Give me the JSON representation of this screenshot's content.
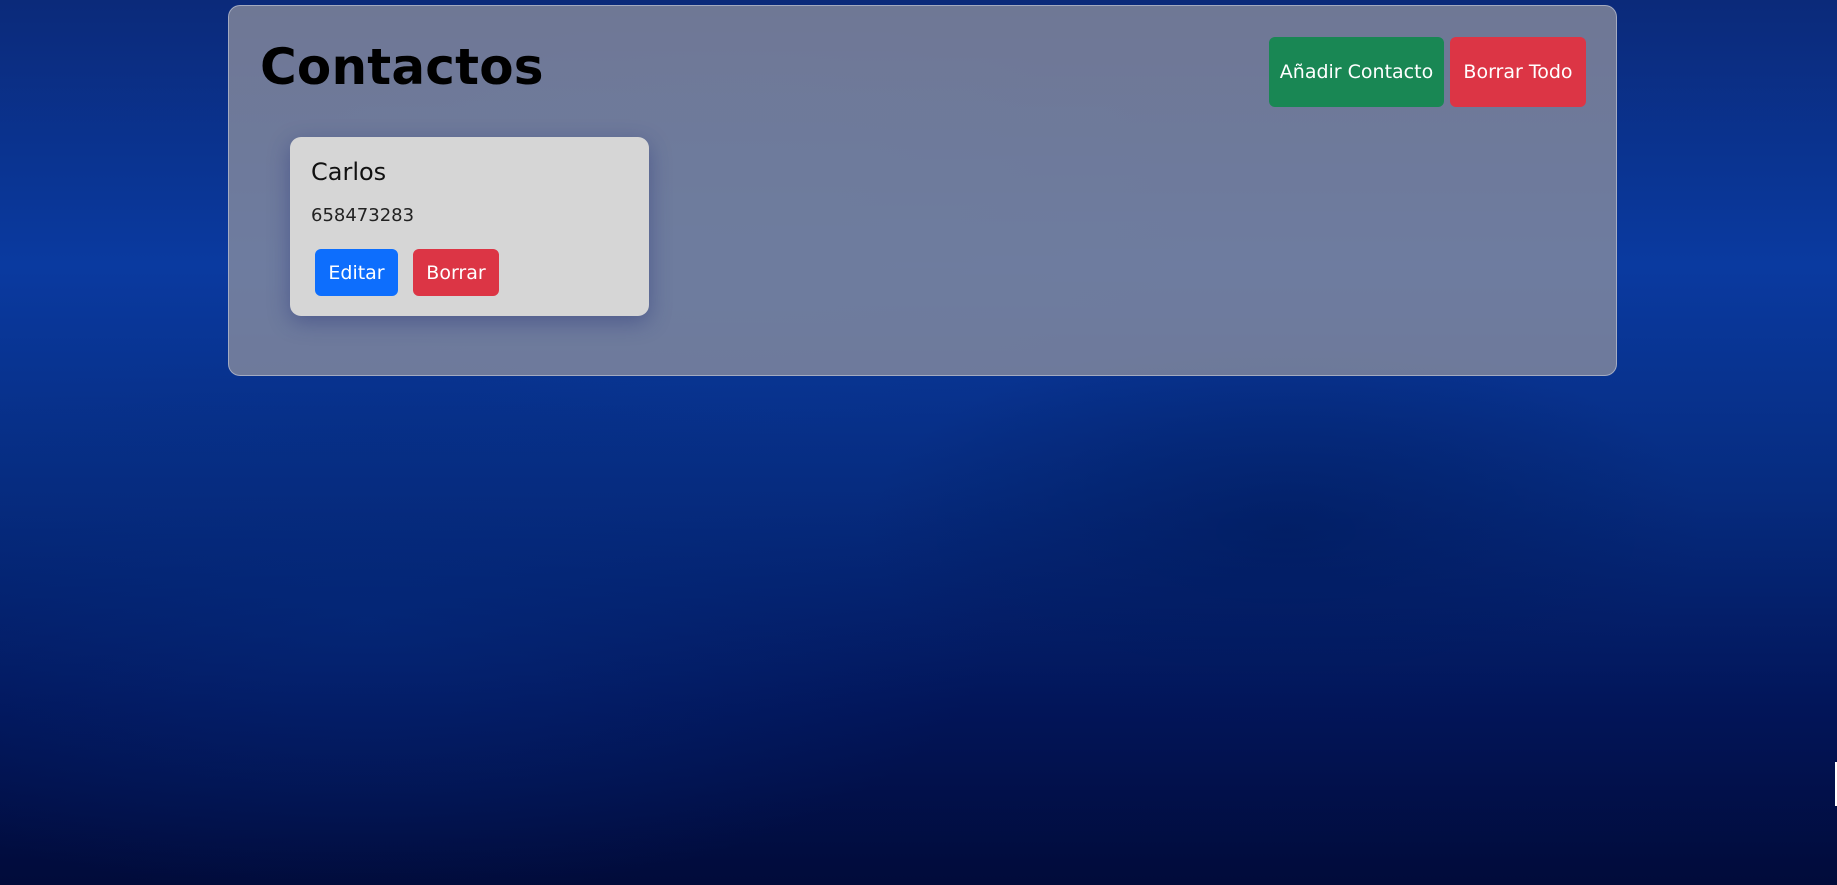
{
  "page": {
    "title": "Contactos"
  },
  "header": {
    "add_label": "Añadir Contacto",
    "clear_all_label": "Borrar Todo"
  },
  "contacts": [
    {
      "name": "Carlos",
      "phone": "658473283",
      "edit_label": "Editar",
      "delete_label": "Borrar"
    }
  ],
  "colors": {
    "add": "#198754",
    "danger": "#dc3545",
    "primary": "#0d6efd",
    "card": "#d6d6d6"
  }
}
